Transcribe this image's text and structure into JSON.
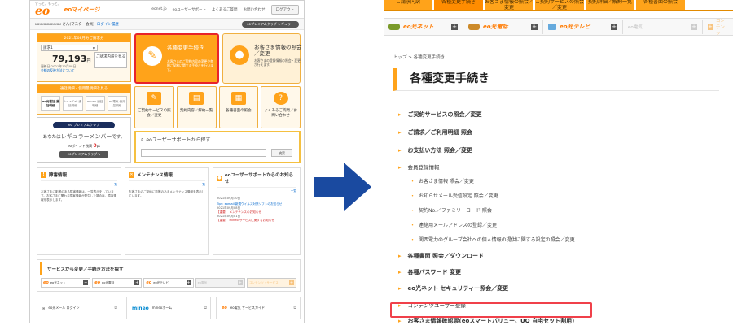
{
  "left": {
    "header": {
      "logo_tag": "ずっと、もっと、",
      "logo": "eo",
      "title": "eoマイページ",
      "nav": [
        "eonet.jp",
        "eoユーザーサポート",
        "よくあるご質問",
        "お問い合わせ"
      ],
      "logout": "ログアウト"
    },
    "userbar": {
      "name": "xxxxxxxxxxxx さん(マスター会員)",
      "login_history": "ログイン履歴",
      "club": "eoプレミアムクラブ レギュラー"
    },
    "billing": {
      "header": "2021年08月分ご請求分",
      "select": "請求1",
      "amount": "79,193",
      "unit": "円",
      "detail_button": "ご請求内訳を見る",
      "note1": "更新日:2021年10月08日",
      "note2": "金額の反映方法について"
    },
    "tools": {
      "header": "通話明細・使用量明細を見る",
      "items": [
        "eo光電話 通話明細",
        "Lut a Call 通話明細",
        "mineo 通話明細",
        "eo電気 使用量明細"
      ]
    },
    "member": {
      "pill": "eo プレミアムクラブ",
      "line_prefix": "あなたは",
      "status": "レギュラーメンバー",
      "line_suffix": "です。",
      "points_label": "eoポイント残高",
      "points": "0",
      "points_unit": "pt",
      "club_button": "eoプレミアムクラブへ"
    },
    "change_card": {
      "title": "各種変更手続き",
      "desc": "お客さまのご契約内容の変更や各種ご契約に関する手続きを行います。"
    },
    "info_card": {
      "title": "お客さま情報の照会／変更",
      "desc": "お客さまの登録情報の照会・変更が行えます。"
    },
    "small_cards": [
      {
        "label": "ご契約サービスの照会／変更",
        "icon": "✎"
      },
      {
        "label": "契約内容／解約一覧",
        "icon": "▤"
      },
      {
        "label": "各種書面の照会",
        "icon": "▦"
      },
      {
        "label": "よくあるご質問／お問い合わせ",
        "icon": "?"
      }
    ],
    "support": {
      "title": "eoユーザーサポートから探す",
      "search_button": "検索"
    },
    "news1": {
      "title": "障害情報",
      "body": "お客さまに影響のある障害情報は、一覧表示をしています。お客さまに関わる障害情報が発生した場合は、障害情報を表示します。",
      "link": "一覧"
    },
    "news2": {
      "title": "メンテナンス情報",
      "body": "お客さまのご契約に影響のあるメンテナンス情報を表示しています。",
      "link": "一覧"
    },
    "news3": {
      "title": "eoユーザーサポートからのお知らせ",
      "link": "一覧",
      "items": [
        "2021年09月10日",
        "Tips: eomail 新規ウイルス対策ソフトのお知らせ",
        "2021年09月08日",
        "【重要】 メンテナンスのお知らせ",
        "2021年09月01日",
        "【重要】 mineo サービスに関するお知らせ"
      ]
    },
    "services": {
      "title": "サービスから変更／手続き方法を探す",
      "tabs": [
        "eo光ネット",
        "eo光電話",
        "eo光テレビ",
        "eo電気",
        "コンテンツ・サービス"
      ]
    },
    "links": [
      "eo光メール ログイン",
      "mineoホーム",
      "eo電気 サービスガイド"
    ]
  },
  "right": {
    "tabs": [
      "ご請求内訳",
      "各種変更手続き",
      "お客さま情報の照会／変更",
      "ご契約サービスの照会／変更",
      "契約詳細／解約一覧",
      "各種書面の照会"
    ],
    "services": [
      "eo光ネット",
      "eo光電話",
      "eo光テレビ",
      "eo電気",
      "コンテンツ"
    ],
    "breadcrumb": "トップ > 各種変更手続き",
    "title": "各種変更手続き",
    "menu": [
      "ご契約サービスの照会／変更",
      "ご請求／ご利用明細 照会",
      "お支払い方法 照会／変更",
      "会員登録情報",
      "お客さま情報 照会／変更",
      "お知らせメール受信設定 照会／変更",
      "契約No.／ファミリーコード 照会",
      "連絡用メールアドレスの登録／変更",
      "関西電力のグループ会社への個人情報の提供に関する設定の照会／変更",
      "各種書面 照会／ダウンロード",
      "各種パスワード 変更",
      "eo光ネット セキュリティー照会／変更",
      "コンテンツユーザー登録",
      "お客さま情報確認票(eoスマートバリュー、UQ 自宅セット割用)"
    ]
  },
  "colors": {
    "accent": "#ffa31a",
    "highlight": "#e8232b",
    "arrow": "#1a4aa0"
  }
}
